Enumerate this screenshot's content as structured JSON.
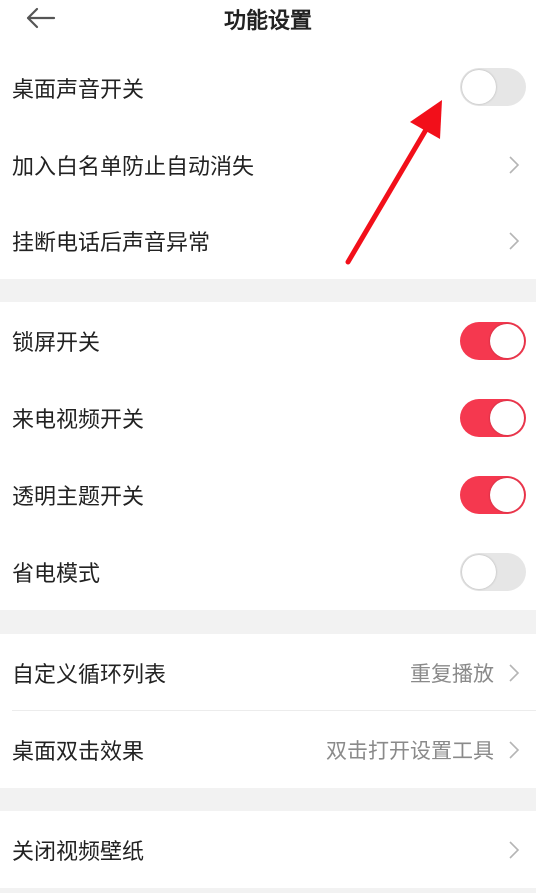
{
  "header": {
    "title": "功能设置",
    "back_icon": "back-arrow-icon"
  },
  "colors": {
    "accent": "#f5384f",
    "toggle_off": "#e6e6e6",
    "annotation_arrow": "#f20f1a"
  },
  "group1": {
    "desktop_sound": {
      "label": "桌面声音开关",
      "on": false
    },
    "whitelist": {
      "label": "加入白名单防止自动消失"
    },
    "hangup_sound": {
      "label": "挂断电话后声音异常"
    }
  },
  "group2": {
    "lock_screen": {
      "label": "锁屏开关",
      "on": true
    },
    "call_video": {
      "label": "来电视频开关",
      "on": true
    },
    "transparent_theme": {
      "label": "透明主题开关",
      "on": true
    },
    "power_saving": {
      "label": "省电模式",
      "on": false
    }
  },
  "group3": {
    "custom_loop": {
      "label": "自定义循环列表",
      "value": "重复播放"
    },
    "desktop_double_click": {
      "label": "桌面双击效果",
      "value": "双击打开设置工具"
    }
  },
  "group4": {
    "close_wallpaper": {
      "label": "关闭视频壁纸"
    }
  }
}
